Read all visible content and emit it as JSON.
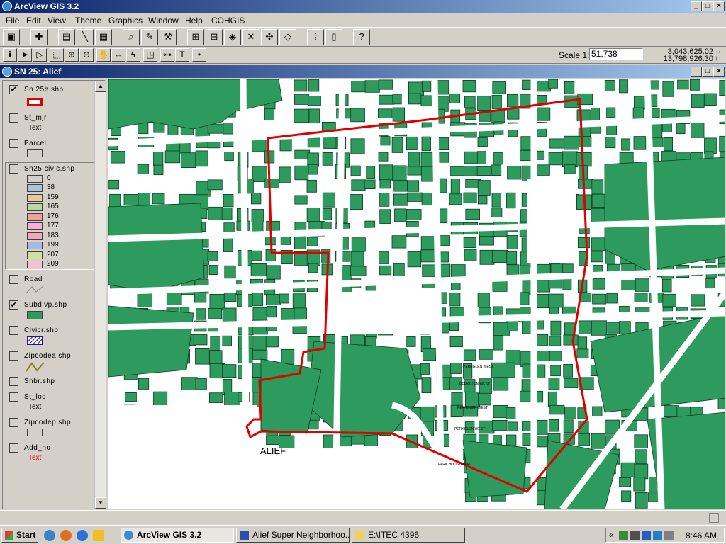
{
  "app": {
    "title": "ArcView GIS 3.2"
  },
  "menu": [
    "File",
    "Edit",
    "View",
    "Theme",
    "Graphics",
    "Window",
    "Help",
    "COHGIS"
  ],
  "toolbar2": {
    "scale_label": "Scale 1:",
    "scale_value": "51,738",
    "coord_x": "3,043,625.02",
    "coord_y": "13,798,926.30",
    "text_tool": "T"
  },
  "view": {
    "title": "SN 25: Alief"
  },
  "legend": {
    "themes": [
      {
        "name": "Sn 25b.shp",
        "checked": true,
        "symbol": "red-outline"
      },
      {
        "name": "St_mjr",
        "checked": false,
        "sub": "Text"
      },
      {
        "name": "Parcel",
        "checked": false,
        "symbol": "gray-box"
      },
      {
        "name": "Sn25 civic.shp",
        "checked": false,
        "classes": [
          "0",
          "38",
          "159",
          "165",
          "176",
          "177",
          "183",
          "199",
          "207",
          "209"
        ]
      },
      {
        "name": "Road",
        "checked": false,
        "symbol": "line"
      },
      {
        "name": "Subdivp.shp",
        "checked": true,
        "symbol": "green-fill"
      },
      {
        "name": "Civicr.shp",
        "checked": false,
        "symbol": "hatch"
      },
      {
        "name": "Zipcodea.shp",
        "checked": false,
        "symbol": "zigzag"
      },
      {
        "name": "Snbr.shp",
        "checked": false
      },
      {
        "name": "St_loc",
        "checked": false,
        "sub": "Text"
      },
      {
        "name": "Zipcodep.shp",
        "checked": false,
        "symbol": "gray-box"
      },
      {
        "name": "Add_no",
        "checked": false,
        "sub": "Text",
        "sub_color": "#cc0000"
      }
    ],
    "class_colors": [
      "#d4d0c8",
      "#a8c4d8",
      "#e8c8a0",
      "#b8d8a8",
      "#f0a0a0",
      "#f8b0d0",
      "#f0a8c0",
      "#a8b8e0",
      "#d0e0a0",
      "#f8c0d0"
    ]
  },
  "map": {
    "label_area": "ALIEF",
    "street_labels": [
      "PERKGLEN WEST",
      "PERKGLEN WEST",
      "PERKGLEN WEST",
      "PERKGLEN WEST",
      "PARK HOUSTON PL"
    ],
    "fill_color": "#2e9b5e",
    "boundary_color": "#e00000"
  },
  "taskbar": {
    "start": "Start",
    "tasks": [
      "ArcView GIS 3.2",
      "Alief Super Neighborhoo...",
      "E:\\ITEC 4396"
    ],
    "clock": "8:46 AM",
    "tray_chevron": "«"
  }
}
